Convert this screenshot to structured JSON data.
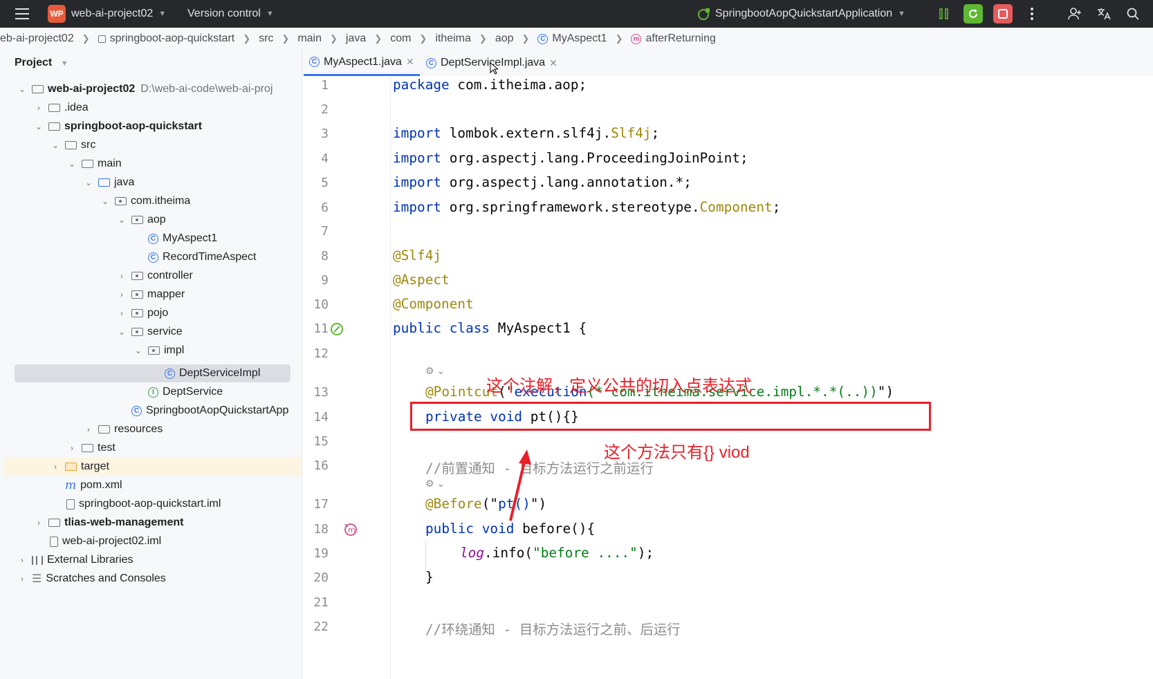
{
  "titlebar": {
    "project_badge": "WP",
    "project_name": "web-ai-project02",
    "vcs_label": "Version control",
    "run_config": "SpringbootAopQuickstartApplication"
  },
  "breadcrumb": [
    "eb-ai-project02",
    "springboot-aop-quickstart",
    "src",
    "main",
    "java",
    "com",
    "itheima",
    "aop",
    "MyAspect1",
    "afterReturning"
  ],
  "project_panel": {
    "title": "Project",
    "tree": [
      {
        "label": "web-ai-project02",
        "path": "D:\\web-ai-code\\web-ai-proj"
      },
      {
        "label": ".idea"
      },
      {
        "label": "springboot-aop-quickstart"
      },
      {
        "label": "src"
      },
      {
        "label": "main"
      },
      {
        "label": "java"
      },
      {
        "label": "com.itheima"
      },
      {
        "label": "aop"
      },
      {
        "label": "MyAspect1"
      },
      {
        "label": "RecordTimeAspect"
      },
      {
        "label": "controller"
      },
      {
        "label": "mapper"
      },
      {
        "label": "pojo"
      },
      {
        "label": "service"
      },
      {
        "label": "impl"
      },
      {
        "label": "DeptServiceImpl"
      },
      {
        "label": "DeptService"
      },
      {
        "label": "SpringbootAopQuickstartApp"
      },
      {
        "label": "resources"
      },
      {
        "label": "test"
      },
      {
        "label": "target"
      },
      {
        "label": "pom.xml"
      },
      {
        "label": "springboot-aop-quickstart.iml"
      },
      {
        "label": "tlias-web-management"
      },
      {
        "label": "web-ai-project02.iml"
      },
      {
        "label": "External Libraries"
      },
      {
        "label": "Scratches and Consoles"
      }
    ]
  },
  "tabs": [
    {
      "label": "MyAspect1.java",
      "active": true
    },
    {
      "label": "DeptServiceImpl.java",
      "active": false
    }
  ],
  "editor": {
    "line_numbers": [
      "1",
      "2",
      "3",
      "4",
      "5",
      "6",
      "7",
      "8",
      "9",
      "10",
      "11",
      "12",
      "13",
      "14",
      "15",
      "16",
      "17",
      "18",
      "19",
      "20",
      "21",
      "22"
    ],
    "code": {
      "l1_kw": "package",
      "l1_rest": " com.itheima.aop;",
      "import_kw": "import",
      "l3_a": " lombok.extern.slf4j.",
      "l3_b": "Slf4j",
      "l3_c": ";",
      "l4_rest": " org.aspectj.lang.ProceedingJoinPoint;",
      "l5_rest": " org.aspectj.lang.annotation.*;",
      "l6_a": " org.springframework.stereotype.",
      "l6_b": "Component",
      "l6_c": ";",
      "l8": "@Slf4j",
      "l9": "@Aspect",
      "l10": "@Component",
      "l11_kw": "public class",
      "l11_rest": " MyAspect1 {",
      "l13_ann": "@Pointcut",
      "l13_p1": "(\"",
      "l13_str": "execution",
      "l13_mid": "(* com.itheima.service.impl.*.*(..))",
      "l13_end": "\")",
      "l14_kw": "private void",
      "l14_rest": " pt(){}",
      "l16": "//前置通知 - 目标方法运行之前运行",
      "l17_ann": "@Before",
      "l17_p1": "(\"",
      "l17_str": "pt()",
      "l17_end": "\")",
      "l18_kw": "public void",
      "l18_rest": " before(){",
      "l19_fld": "log",
      "l19_mid": ".info(",
      "l19_str": "\"before ....\"",
      "l19_end": ");",
      "l20": "}",
      "l22": "//环绕通知 - 目标方法运行之前、后运行"
    }
  },
  "annotations": {
    "note1": "这个注解，定义公共的切入点表达式",
    "note2": "这个方法只有{} viod"
  },
  "colors": {
    "keyword": "#0033b3",
    "annotation": "#9e880d",
    "string": "#067d17",
    "comment": "#8c8c8c",
    "highlight_red": "#e8202a",
    "accent": "#3574f0"
  }
}
